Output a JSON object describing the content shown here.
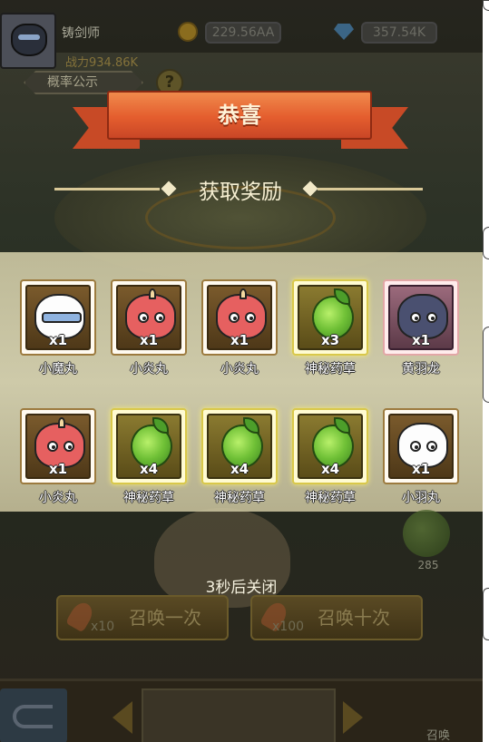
{
  "hud": {
    "player_name": "铸剑师",
    "power": "战力934.86K",
    "gold": "229.56AA",
    "gems": "357.54K",
    "rate_button": "概率公示",
    "help": "?"
  },
  "popup": {
    "title": "恭喜",
    "subtitle": "获取奖励",
    "close_timer": "3秒后关闭",
    "rewards": [
      {
        "name": "小魔丸",
        "qty": "x1",
        "kind": "goggle-cat",
        "rarity": "brown"
      },
      {
        "name": "小炎丸",
        "qty": "x1",
        "kind": "red-cat",
        "rarity": "brown"
      },
      {
        "name": "小炎丸",
        "qty": "x1",
        "kind": "red-cat",
        "rarity": "brown"
      },
      {
        "name": "神秘药草",
        "qty": "x3",
        "kind": "herb",
        "rarity": "yellow"
      },
      {
        "name": "黄羽龙",
        "qty": "x1",
        "kind": "dragon",
        "rarity": "pink"
      },
      {
        "name": "小炎丸",
        "qty": "x1",
        "kind": "red-cat",
        "rarity": "brown"
      },
      {
        "name": "神秘药草",
        "qty": "x4",
        "kind": "herb",
        "rarity": "yellow"
      },
      {
        "name": "神秘药草",
        "qty": "x4",
        "kind": "herb",
        "rarity": "yellow"
      },
      {
        "name": "神秘药草",
        "qty": "x4",
        "kind": "herb",
        "rarity": "yellow"
      },
      {
        "name": "小羽丸",
        "qty": "x1",
        "kind": "white-cat",
        "rarity": "brown"
      }
    ]
  },
  "summon": {
    "once": {
      "label": "召唤一次",
      "cost": "x10"
    },
    "ten": {
      "label": "召唤十次",
      "cost": "x100"
    }
  },
  "side": {
    "herb_count": "285"
  },
  "bottom": {
    "label": "召唤"
  }
}
